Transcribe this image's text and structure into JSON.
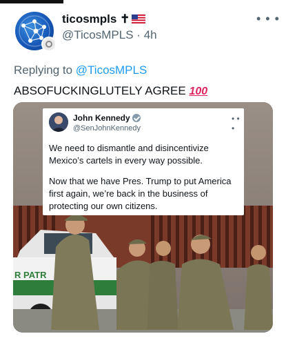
{
  "author": {
    "display_name": "ticosmpls ✝",
    "handle": "@TicosMPLS",
    "separator": "·",
    "time": "4h"
  },
  "reply": {
    "prefix": "Replying to ",
    "mention": "@TicosMPLS"
  },
  "tweet": {
    "text": "ABSOFUCKINGLUTELY AGREE ",
    "emoji": "100"
  },
  "embedded_tweet": {
    "name": "John Kennedy",
    "handle": "@SenJohnKennedy",
    "paragraph1": "We need to dismantle and disincentivize Mexico’s cartels in every way possible.",
    "paragraph2": "Now that we have Pres. Trump to put America first again, we’re back in the business of protecting our own citizens."
  },
  "photo": {
    "vehicle_text": "R PATR"
  },
  "icons": {
    "more": "more-horizontal-icon",
    "verified": "verified-badge-icon",
    "flag": "us-flag-icon"
  },
  "colors": {
    "link": "#1d9bf0",
    "secondary_text": "#536471",
    "primary_text": "#0f1419"
  }
}
